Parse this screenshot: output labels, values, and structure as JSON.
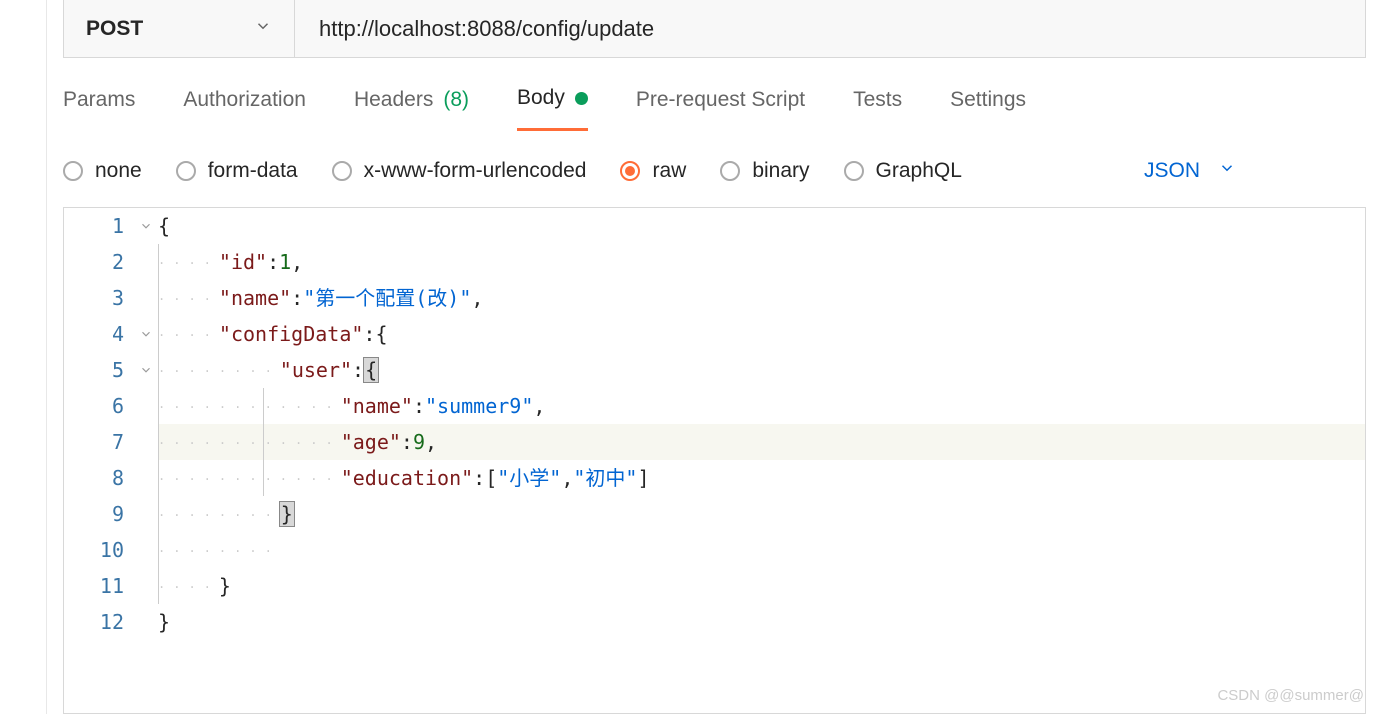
{
  "request": {
    "method": "POST",
    "url": "http://localhost:8088/config/update"
  },
  "tabs": {
    "params": "Params",
    "authorization": "Authorization",
    "headers": "Headers",
    "headers_count": "(8)",
    "body": "Body",
    "pre_request": "Pre-request Script",
    "tests": "Tests",
    "settings": "Settings"
  },
  "body_options": {
    "none": "none",
    "form_data": "form-data",
    "urlencoded": "x-www-form-urlencoded",
    "raw": "raw",
    "binary": "binary",
    "graphql": "GraphQL"
  },
  "content_type": "JSON",
  "editor": {
    "lines": [
      "1",
      "2",
      "3",
      "4",
      "5",
      "6",
      "7",
      "8",
      "9",
      "10",
      "11",
      "12"
    ],
    "json_body": {
      "id": 1,
      "name": "第一个配置(改)",
      "configData": {
        "user": {
          "name": "summer9",
          "age": 9,
          "education": [
            "小学",
            "初中"
          ]
        }
      }
    },
    "tokens": {
      "id_key": "\"id\"",
      "id_val": "1",
      "name_key": "\"name\"",
      "name_val": "\"第一个配置(改)\"",
      "config_key": "\"configData\"",
      "user_key": "\"user\"",
      "uname_key": "\"name\"",
      "uname_val": "\"summer9\"",
      "age_key": "\"age\"",
      "age_val": "9",
      "edu_key": "\"education\"",
      "edu_v1": "\"小学\"",
      "edu_v2": "\"初中\""
    }
  },
  "watermark": "CSDN @@summer@"
}
